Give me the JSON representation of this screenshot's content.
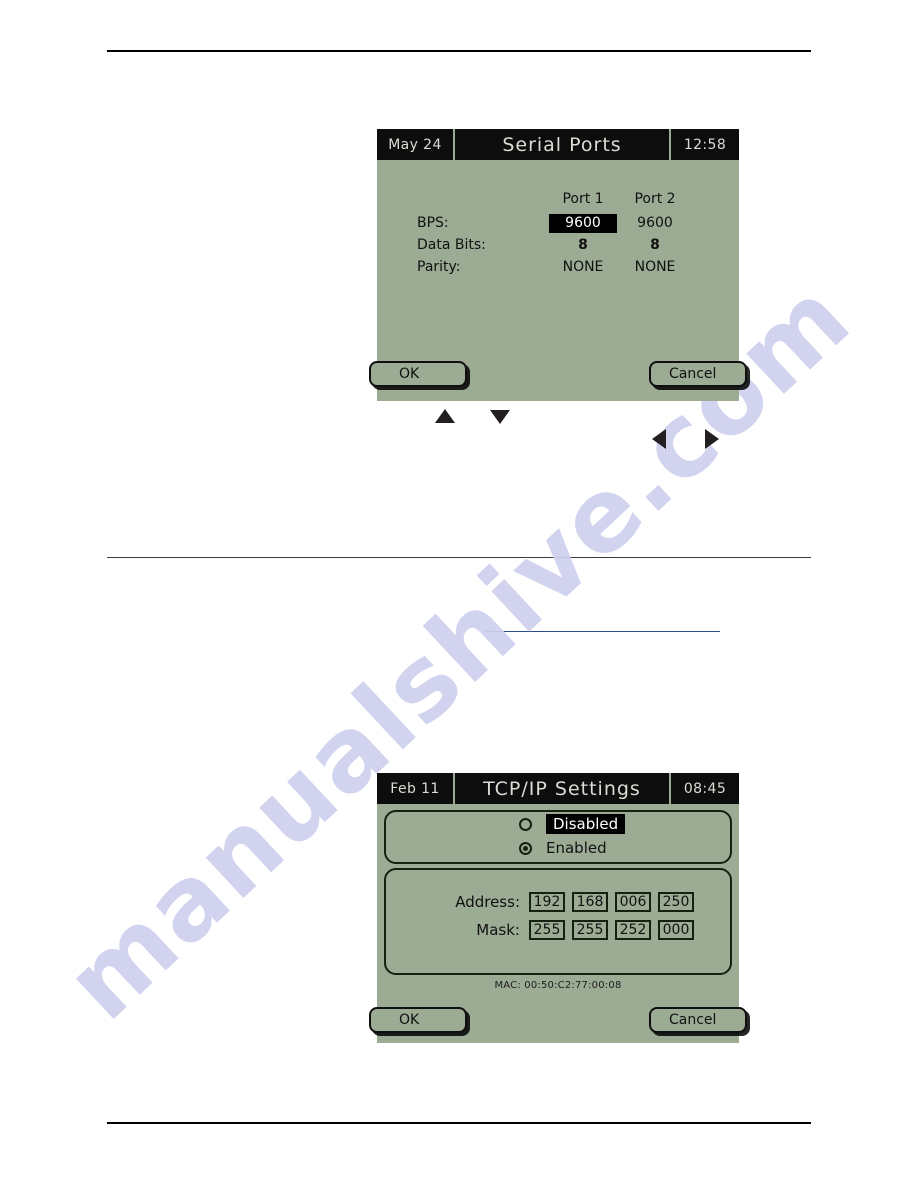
{
  "page": {
    "watermark": "manualshive.com"
  },
  "serial_screen": {
    "header": {
      "date": "May 24",
      "title": "Serial Ports",
      "time": "12:58"
    },
    "columns": [
      "Port 1",
      "Port 2"
    ],
    "rows": [
      {
        "label": "BPS:",
        "port1": "9600",
        "port2": "9600",
        "port1_selected": true
      },
      {
        "label": "Data Bits:",
        "port1": "8",
        "port2": "8",
        "port1_selected": false
      },
      {
        "label": "Parity:",
        "port1": "NONE",
        "port2": "NONE",
        "port1_selected": false
      }
    ],
    "buttons": {
      "ok": "OK",
      "cancel": "Cancel"
    }
  },
  "keypad": {
    "arrows": [
      "up-arrow",
      "down-arrow",
      "left-arrow",
      "right-arrow"
    ]
  },
  "tcpip_screen": {
    "header": {
      "date": "Feb 11",
      "title": "TCP/IP Settings",
      "time": "08:45"
    },
    "mode_options": [
      {
        "label": "Disabled",
        "selected": false,
        "highlighted": true
      },
      {
        "label": "Enabled",
        "selected": true,
        "highlighted": false
      }
    ],
    "network": {
      "address_label": "Address:",
      "address_octets": [
        "192",
        "168",
        "006",
        "250"
      ],
      "mask_label": "Mask:",
      "mask_octets": [
        "255",
        "255",
        "252",
        "000"
      ]
    },
    "mac": "MAC: 00:50:C2:77:00:08",
    "buttons": {
      "ok": "OK",
      "cancel": "Cancel"
    }
  },
  "colors": {
    "lcd_background": "#9cab94",
    "lcd_header": "#0d0d0d",
    "lcd_text": "#111111",
    "watermark": "#cfd0ee",
    "link_rule": "#2a4d8f"
  }
}
